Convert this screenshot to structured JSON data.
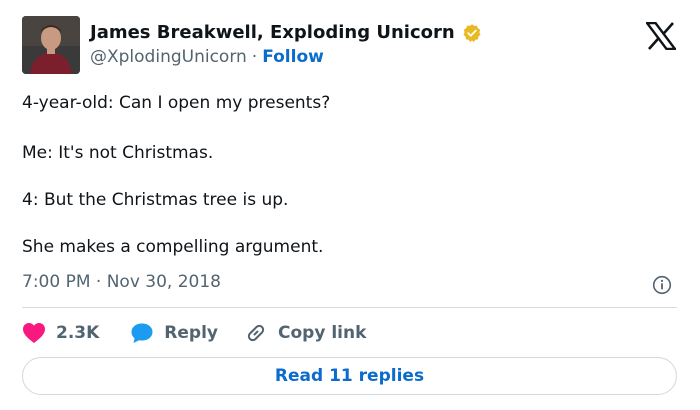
{
  "author": {
    "display_name": "James Breakwell, Exploding Unicorn",
    "handle": "@XplodingUnicorn",
    "separator": "·",
    "follow_label": "Follow",
    "verified_color": "#e8b923"
  },
  "tweet": {
    "lines": [
      "4-year-old: Can I open my presents?",
      "Me: It's not Christmas.",
      "4: But the Christmas tree is up.",
      "She makes a compelling argument."
    ],
    "timestamp": "7:00 PM · Nov 30, 2018"
  },
  "actions": {
    "like_count": "2.3K",
    "reply_label": "Reply",
    "copy_link_label": "Copy link"
  },
  "read_replies_label": "Read 11 replies",
  "icons": [
    "x-logo-icon",
    "verified-badge-icon",
    "info-icon",
    "heart-icon",
    "reply-bubble-icon",
    "link-icon"
  ],
  "colors": {
    "accent": "#0b6ccc",
    "heart": "#f91880",
    "secondary_text": "#536471",
    "border": "#cfd9de"
  }
}
